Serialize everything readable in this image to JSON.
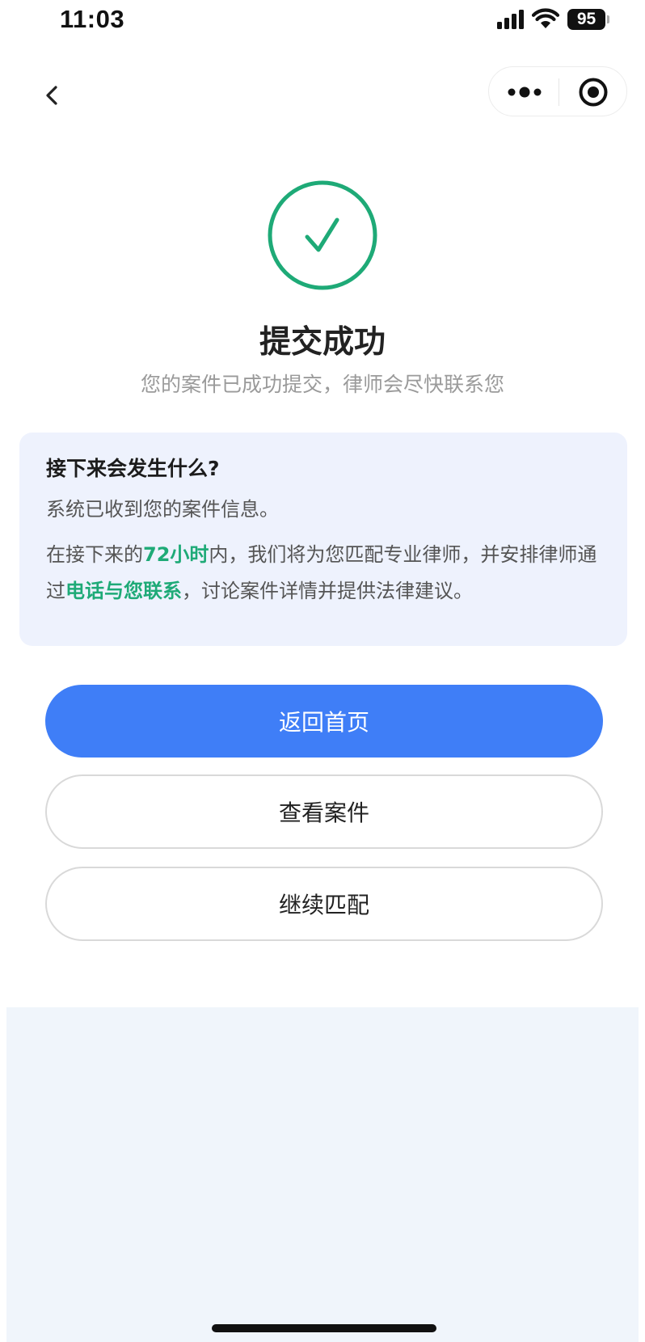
{
  "status_bar": {
    "time": "11:03",
    "battery": "95",
    "icons": [
      "signal-icon",
      "wifi-icon",
      "battery-icon"
    ]
  },
  "nav": {
    "back_icon": "chevron-left-icon",
    "capsule_icons": [
      "more-dots-icon",
      "target-circle-icon"
    ]
  },
  "result": {
    "icon": "check-circle-icon",
    "title": "提交成功",
    "subtitle": "您的案件已成功提交，律师会尽快联系您"
  },
  "info_card": {
    "heading": "接下来会发生什么?",
    "line1": "系统已收到您的案件信息。",
    "para_part1": "在接下来的",
    "para_highlight1": "72小时",
    "para_part2": "内，我们将为您匹配专业律师，并安排律师通过",
    "para_highlight2": "电话与您联系",
    "para_part3": "，讨论案件详情并提供法律建议。"
  },
  "buttons": {
    "home": "返回首页",
    "view_case": "查看案件",
    "continue_match": "继续匹配"
  },
  "colors": {
    "success_green": "#1eaa77",
    "primary_blue": "#3f7ef7",
    "card_bg": "#eef2fd",
    "bottom_bg": "#f0f5fb"
  }
}
